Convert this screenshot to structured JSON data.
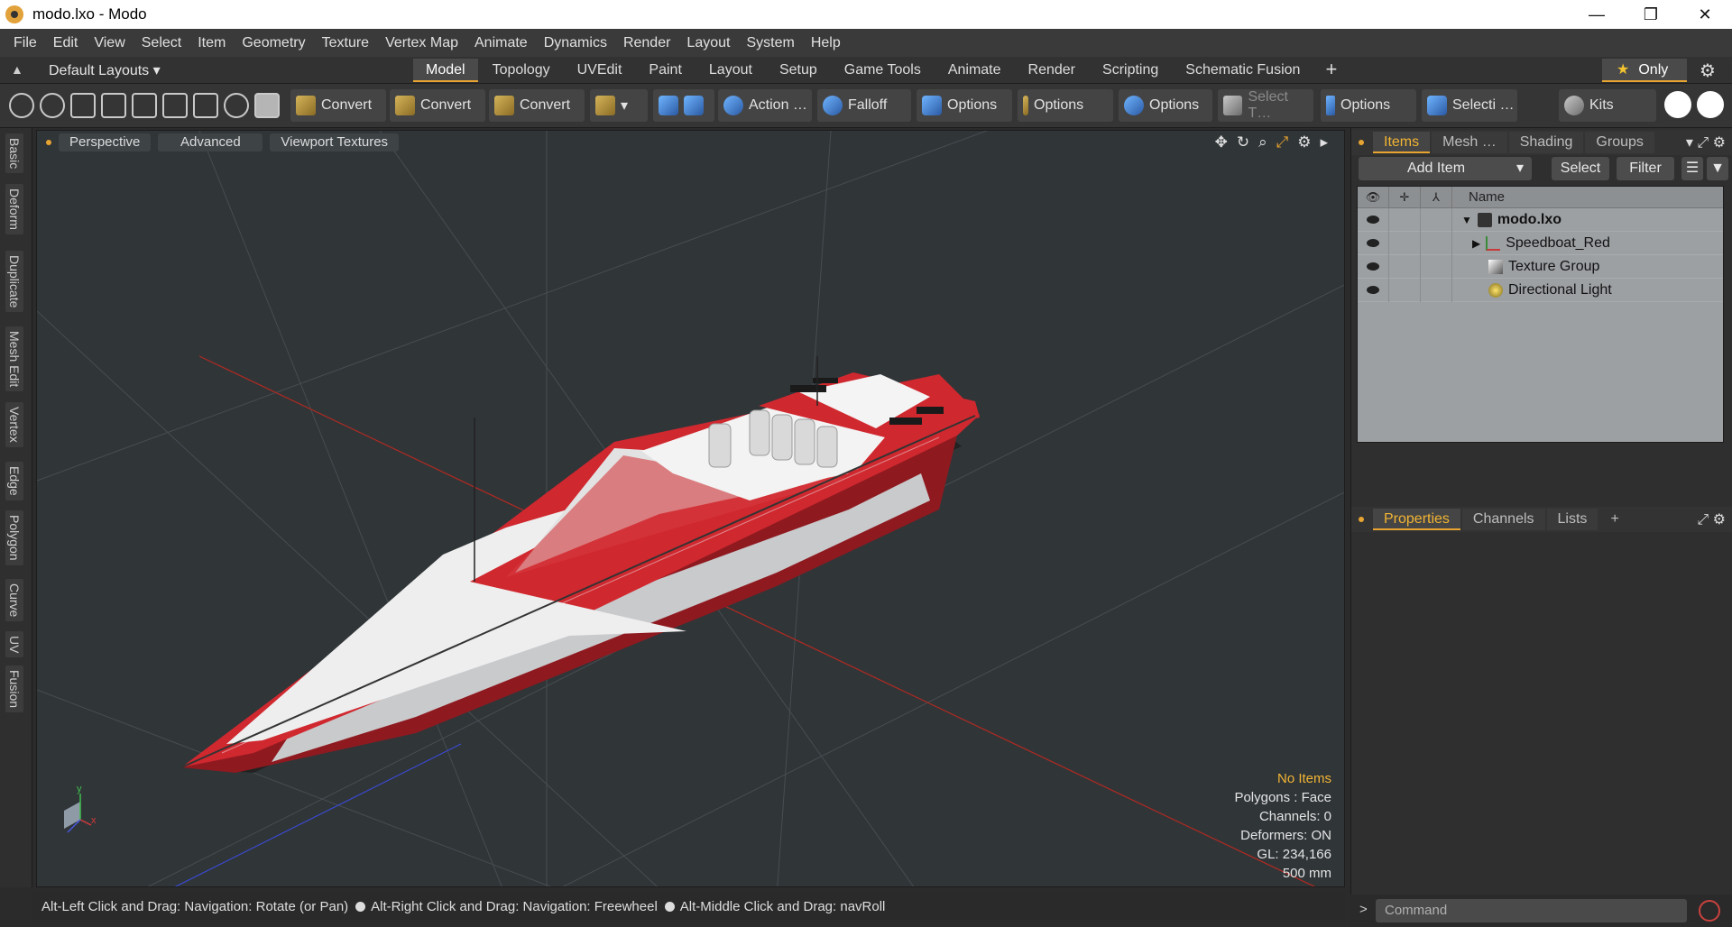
{
  "window": {
    "title": "modo.lxo - Modo",
    "minimize": "—",
    "restore": "❐",
    "close": "✕"
  },
  "menu": [
    "File",
    "Edit",
    "View",
    "Select",
    "Item",
    "Geometry",
    "Texture",
    "Vertex Map",
    "Animate",
    "Dynamics",
    "Render",
    "Layout",
    "System",
    "Help"
  ],
  "layoutbar": {
    "layout_label": "Default Layouts ▾",
    "tabs": [
      "Model",
      "Topology",
      "UVEdit",
      "Paint",
      "Layout",
      "Setup",
      "Game Tools",
      "Animate",
      "Render",
      "Scripting",
      "Schematic Fusion"
    ],
    "active_tab": "Model",
    "plus": "+",
    "only_label": "Only",
    "only_star": "★",
    "gear": "⚙"
  },
  "toolbar": {
    "convert1": "Convert",
    "convert2": "Convert",
    "convert3": "Convert",
    "action": "Action   …",
    "falloff": "Falloff",
    "options1": "Options",
    "options2": "Options",
    "options3": "Options",
    "select_t": "Select T…",
    "options4": "Options",
    "selecti": "Selecti …",
    "kits": "Kits",
    "dropdown": "▾"
  },
  "left_tabs": [
    "Basic",
    "Deform",
    "Duplicate",
    "Mesh Edit",
    "Vertex",
    "Edge",
    "Polygon",
    "Curve",
    "UV",
    "Fusion"
  ],
  "viewport": {
    "tabs": [
      "Perspective",
      "Advanced",
      "Viewport Textures"
    ],
    "icons": {
      "move": "✥",
      "rotate": "↻",
      "zoom": "⌕",
      "maximize": "⤢",
      "gear": "⚙",
      "more": "▸"
    },
    "info": {
      "selection": "No Items",
      "polygons": "Polygons : Face",
      "channels": "Channels: 0",
      "deformers": "Deformers: ON",
      "gl": "GL: 234,166",
      "scale": "500 mm"
    },
    "axis_labels": {
      "x": "x",
      "y": "y"
    }
  },
  "status": {
    "hint1": "Alt-Left Click and Drag: Navigation: Rotate (or Pan)",
    "hint2": "Alt-Right Click and Drag: Navigation: Freewheel",
    "hint3": "Alt-Middle Click and Drag: navRoll"
  },
  "items_panel": {
    "tabs": [
      "Items",
      "Mesh …",
      "Shading",
      "Groups"
    ],
    "active_tab": "Items",
    "more": "▾",
    "add_item": "Add Item",
    "add_item_arrow": "▾",
    "select": "Select",
    "filter": "Filter",
    "column_name": "Name",
    "rows": [
      {
        "name": "modo.lxo",
        "expander": "▼"
      },
      {
        "name": "Speedboat_Red",
        "expander": "▶"
      },
      {
        "name": "Texture Group",
        "expander": ""
      },
      {
        "name": "Directional Light",
        "expander": ""
      }
    ]
  },
  "properties_panel": {
    "tabs": [
      "Properties",
      "Channels",
      "Lists"
    ],
    "active_tab": "Properties",
    "plus": "+"
  },
  "command": {
    "placeholder": "Command",
    "arrow": ">"
  },
  "colors": {
    "accent": "#e8a430",
    "hull_red": "#c8232b",
    "viewport_bg": "#303538",
    "selection_text": "#f2b433"
  }
}
